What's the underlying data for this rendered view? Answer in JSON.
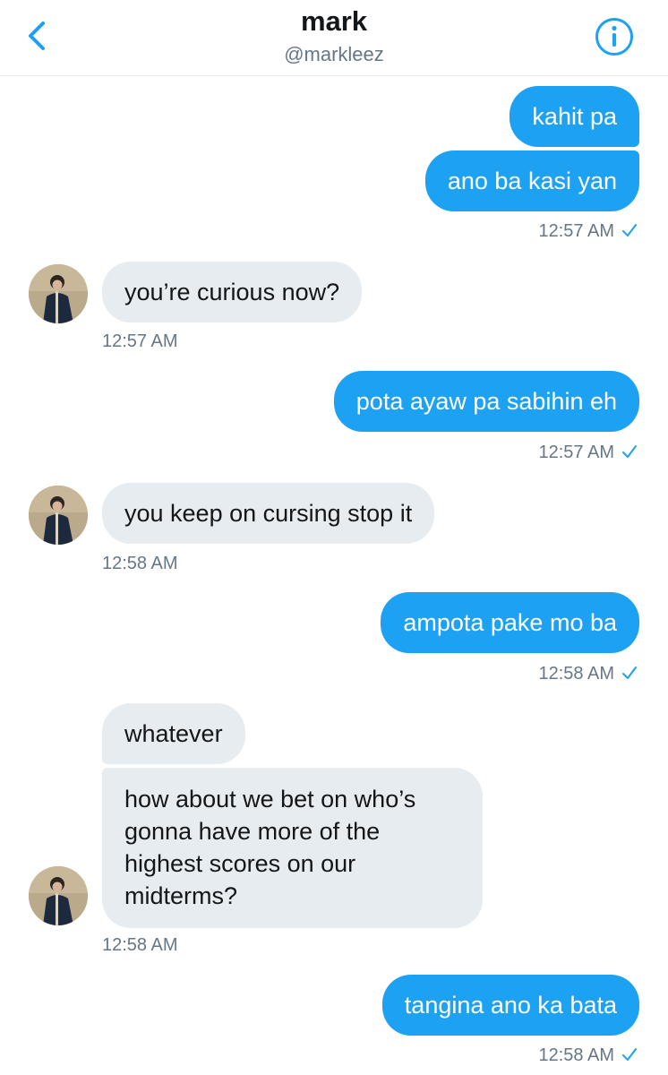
{
  "header": {
    "name": "mark",
    "handle": "@markleez"
  },
  "colors": {
    "accent": "#1da1f2",
    "incoming_bubble": "#e6ecf0",
    "timestamp": "#657786"
  },
  "icons": {
    "back": "chevron-left-icon",
    "info": "info-circle-icon",
    "read_receipt": "checkmark-icon"
  },
  "messages": [
    {
      "direction": "outgoing",
      "text": "kahit pa"
    },
    {
      "direction": "outgoing",
      "text": "ano ba kasi yan"
    },
    {
      "direction": "timestamp-outgoing",
      "text": "12:57 AM"
    },
    {
      "direction": "incoming",
      "text": "you’re curious now?"
    },
    {
      "direction": "timestamp-incoming",
      "text": "12:57 AM"
    },
    {
      "direction": "outgoing",
      "text": "pota ayaw pa sabihin eh"
    },
    {
      "direction": "timestamp-outgoing",
      "text": "12:57 AM"
    },
    {
      "direction": "incoming",
      "text": "you keep on cursing stop it"
    },
    {
      "direction": "timestamp-incoming",
      "text": "12:58 AM"
    },
    {
      "direction": "outgoing",
      "text": "ampota pake mo ba"
    },
    {
      "direction": "timestamp-outgoing",
      "text": "12:58 AM"
    },
    {
      "direction": "incoming",
      "text": "whatever"
    },
    {
      "direction": "incoming",
      "text": "how about we bet on who’s gonna have more of the highest scores on our midterms?"
    },
    {
      "direction": "timestamp-incoming",
      "text": "12:58 AM"
    },
    {
      "direction": "outgoing",
      "text": "tangina ano ka bata"
    },
    {
      "direction": "timestamp-outgoing",
      "text": "12:58 AM"
    }
  ]
}
